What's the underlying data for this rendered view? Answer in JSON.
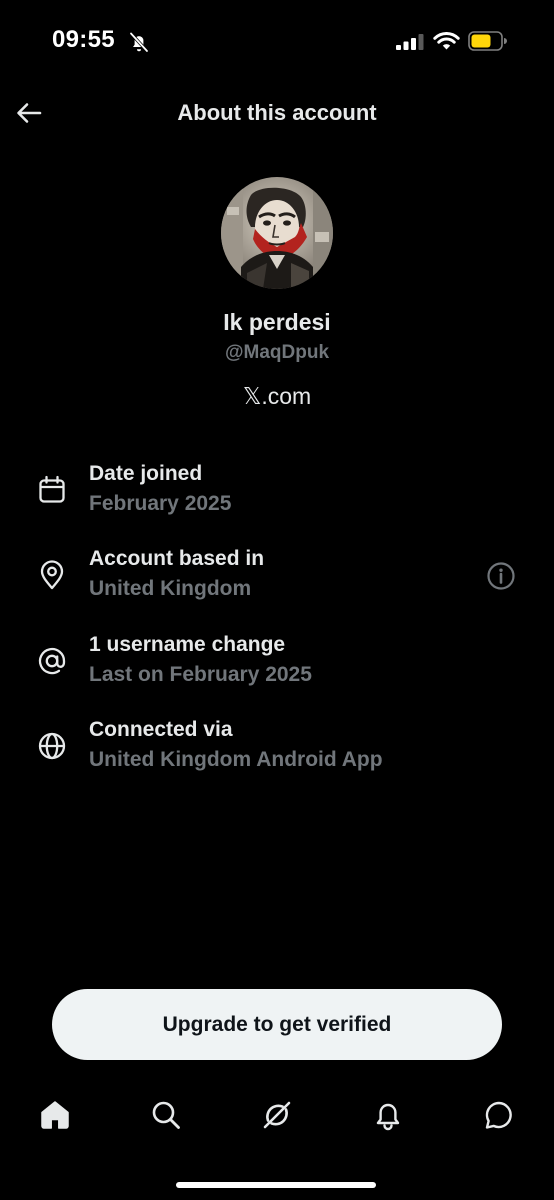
{
  "status_bar": {
    "time": "09:55",
    "icons": [
      "bell-off-icon",
      "signal-icon",
      "wifi-icon",
      "battery-icon"
    ],
    "battery_color": "#ffd60a"
  },
  "header": {
    "title": "About this account",
    "back_icon": "arrow-left-icon"
  },
  "profile": {
    "display_name": "Ik perdesi",
    "handle": "@MaqDpuk",
    "site": "𝕏.com"
  },
  "info_rows": [
    {
      "icon": "calendar-icon",
      "title": "Date joined",
      "subtitle": "February 2025"
    },
    {
      "icon": "location-pin-icon",
      "title": "Account based in",
      "subtitle": "United Kingdom",
      "trailing_icon": "info-circle-icon"
    },
    {
      "icon": "at-sign-icon",
      "title": "1 username change",
      "subtitle": "Last on February 2025"
    },
    {
      "icon": "globe-icon",
      "title": "Connected via",
      "subtitle": "United Kingdom Android App"
    }
  ],
  "upgrade_button": {
    "label": "Upgrade to get verified"
  },
  "tabbar": {
    "items": [
      "home-icon",
      "search-icon",
      "grok-icon",
      "notifications-bell-icon",
      "messages-icon"
    ]
  },
  "colors": {
    "background": "#000000",
    "primary_text": "#e7e9ea",
    "secondary_text": "#71767b",
    "button_bg": "#eff3f4",
    "button_text": "#0f1419"
  }
}
